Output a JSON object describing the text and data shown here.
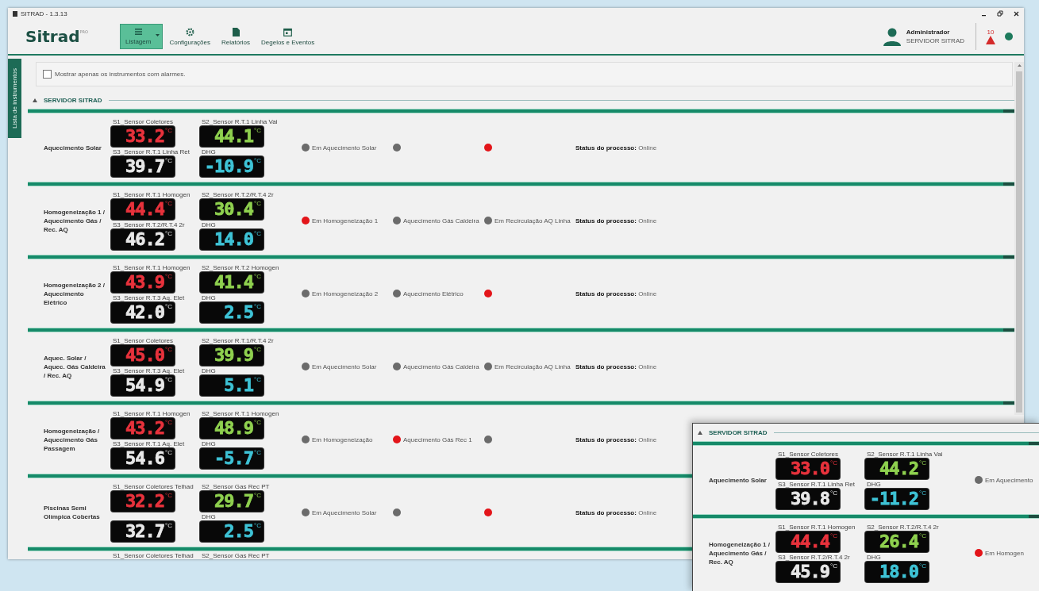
{
  "window": {
    "title": "SITRAD - 1.3.13"
  },
  "header": {
    "logo": "Sitrad",
    "logo_badge": "PRO",
    "nav": [
      {
        "label": "Listagem",
        "selected": true,
        "dropdown": true
      },
      {
        "label": "Configurações",
        "selected": false,
        "dropdown": false
      },
      {
        "label": "Relatórios",
        "selected": false,
        "dropdown": false
      },
      {
        "label": "Degelos e Eventos",
        "selected": false,
        "dropdown": false
      }
    ],
    "user": {
      "name": "Administrador",
      "server": "SERVIDOR SITRAD"
    },
    "alarm_count": "10"
  },
  "side_tab": "Lista de instrumentos",
  "filter": {
    "label": "Mostrar apenas os instrumentos com alarmes.",
    "checked": false
  },
  "section": {
    "title": "SERVIDOR SITRAD",
    "expanded": true
  },
  "rows": [
    {
      "name": "Aquecimento Solar",
      "displays": [
        {
          "label": "S1_Sensor Coletores",
          "value": "33.2",
          "unit": "°C"
        },
        {
          "label": "S2_Sensor R.T.1 Linha Vai",
          "value": "44.1",
          "unit": "°C"
        },
        {
          "label": "S3_Sensor R.T.1 Linha Ret",
          "value": "39.7",
          "unit": "°C"
        },
        {
          "label": "DHG",
          "value": "-10.9",
          "unit": "°C"
        }
      ],
      "indicators": [
        {
          "label": "Em Aquecimento Solar",
          "on": false
        },
        {
          "on": false
        },
        {
          "on": true
        }
      ],
      "status_label": "Status do processo:",
      "status": "Online"
    },
    {
      "name": "Homogeneização 1 / Aquecimento Gás / Rec. AQ",
      "displays": [
        {
          "label": "S1_Sensor R.T.1 Homogen",
          "value": "44.4",
          "unit": "°C"
        },
        {
          "label": "S2_Sensor R.T.2/R.T.4 2r",
          "value": "30.4",
          "unit": "°C"
        },
        {
          "label": "S3_Sensor R.T.2/R.T.4 2r",
          "value": "46.2",
          "unit": "°C"
        },
        {
          "label": "DHG",
          "value": "14.0",
          "unit": "°C"
        }
      ],
      "indicators": [
        {
          "label": "Em Homogeneização 1",
          "on": true
        },
        {
          "label": "Aquecimento Gás Caldeira",
          "on": false
        },
        {
          "label": "Em Recirculação AQ Linha",
          "on": false
        }
      ],
      "status_label": "Status do processo:",
      "status": "Online"
    },
    {
      "name": "Homogeneização 2 / Aquecimento Elétrico",
      "displays": [
        {
          "label": "S1_Sensor R.T.1 Homogen",
          "value": "43.9",
          "unit": "°C"
        },
        {
          "label": "S2_Sensor R.T.2 Homogen",
          "value": "41.4",
          "unit": "°C"
        },
        {
          "label": "S3_Sensor R.T.3 Aq. Elet",
          "value": "42.0",
          "unit": "°C"
        },
        {
          "label": "DHG",
          "value": "2.5",
          "unit": "°C"
        }
      ],
      "indicators": [
        {
          "label": "Em Homogeneização 2",
          "on": false
        },
        {
          "label": "Aquecimento Elétrico",
          "on": false
        },
        {
          "on": true
        }
      ],
      "status_label": "Status do processo:",
      "status": "Online"
    },
    {
      "name": "Aquec. Solar / Aquec. Gás Caldeira / Rec. AQ",
      "displays": [
        {
          "label": "S1_Sensor Coletores",
          "value": "45.0",
          "unit": "°C"
        },
        {
          "label": "S2_Sensor R.T.1/R.T.4 2r",
          "value": "39.9",
          "unit": "°C"
        },
        {
          "label": "S3_Sensor R.T.3 Aq. Elet",
          "value": "54.9",
          "unit": "°C"
        },
        {
          "label": "DHG",
          "value": "5.1",
          "unit": "°C"
        }
      ],
      "indicators": [
        {
          "label": "Em Aquecimento Solar",
          "on": false
        },
        {
          "label": "Aquecimento Gás Caldeira",
          "on": false
        },
        {
          "label": "Em Recirculação AQ Linha",
          "on": false
        }
      ],
      "status_label": "Status do processo:",
      "status": "Online"
    },
    {
      "name": "Homogeneização / Aquecimento Gás Passagem",
      "displays": [
        {
          "label": "S1_Sensor R.T.1 Homogen",
          "value": "43.2",
          "unit": "°C"
        },
        {
          "label": "S2_Sensor R.T.1 Homogen",
          "value": "48.9",
          "unit": "°C"
        },
        {
          "label": "S3_Sensor R.T.1 Aq. Elet",
          "value": "54.6",
          "unit": "°C"
        },
        {
          "label": "DHG",
          "value": "-5.7",
          "unit": "°C"
        }
      ],
      "indicators": [
        {
          "label": "Em Homogeneização",
          "on": false
        },
        {
          "label": "Aquecimento Gás Rec 1",
          "on": true
        },
        {
          "on": false
        }
      ],
      "status_label": "Status do processo:",
      "status": "Online"
    },
    {
      "name": "Piscinas Semi Olímpica Cobertas",
      "displays": [
        {
          "label": "S1_Sensor Coletores Telhad",
          "value": "32.2",
          "unit": "°C"
        },
        {
          "label": "S2_Sensor Gas Rec PT",
          "value": "29.7",
          "unit": "°C"
        },
        {
          "value": "32.7",
          "unit": "°C"
        },
        {
          "label": "DHG",
          "value": "2.5",
          "unit": "°C"
        }
      ],
      "indicators": [
        {
          "label": "Em Aquecimento Solar",
          "on": false
        },
        {
          "on": false
        },
        {
          "on": true
        }
      ],
      "status_label": "Status do processo:",
      "status": "Online"
    }
  ],
  "cut_row": {
    "sensor_labels": [
      "S1_Sensor Coletores Telhad",
      "S2_Sensor Gas Rec PT"
    ]
  },
  "inset": {
    "section": {
      "title": "SERVIDOR SITRAD",
      "expanded": true
    },
    "rows": [
      {
        "name": "Aquecimento Solar",
        "displays": [
          {
            "label": "S1_Sensor Coletores",
            "value": "33.0",
            "unit": "°C"
          },
          {
            "label": "S2_Sensor R.T.1 Linha Vai",
            "value": "44.2",
            "unit": "°C"
          },
          {
            "label": "S3_Sensor R.T.1 Linha Ret",
            "value": "39.8",
            "unit": "°C"
          },
          {
            "label": "DHG",
            "value": "-11.2",
            "unit": "°C"
          }
        ],
        "indicators": [
          {
            "label": "Em Aquecimento",
            "on": false
          }
        ]
      },
      {
        "name": "Homogeneização 1 / Aquecimento Gás / Rec. AQ",
        "displays": [
          {
            "label": "S1_Sensor R.T.1 Homogen",
            "value": "44.4",
            "unit": "°C"
          },
          {
            "label": "S2_Sensor R.T.2/R.T.4 2r",
            "value": "26.4",
            "unit": "°C"
          },
          {
            "label": "S3_Sensor R.T.2/R.T.4 2r",
            "value": "45.9",
            "unit": "°C"
          },
          {
            "label": "DHG",
            "value": "18.0",
            "unit": "°C"
          }
        ],
        "indicators": [
          {
            "label": "Em Homogen",
            "on": true
          }
        ]
      }
    ]
  }
}
